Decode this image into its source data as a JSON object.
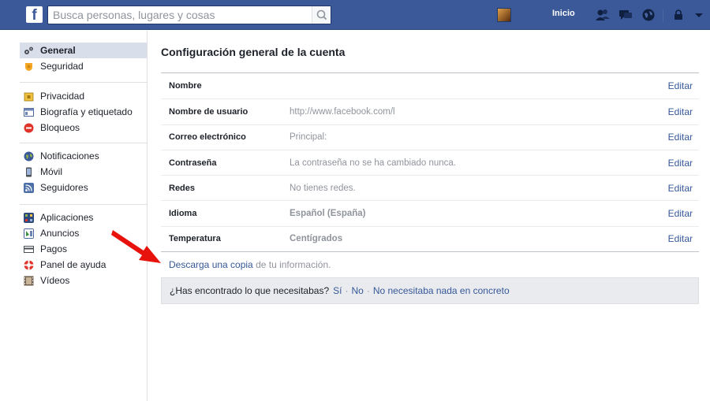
{
  "topbar": {
    "logo": "f",
    "search_placeholder": "Busca personas, lugares y cosas",
    "home_label": "Inicio"
  },
  "sidebar": {
    "groups": [
      [
        {
          "label": "General",
          "icon": "gear-icon",
          "active": true
        },
        {
          "label": "Seguridad",
          "icon": "badge-icon"
        }
      ],
      [
        {
          "label": "Privacidad",
          "icon": "lock-icon"
        },
        {
          "label": "Biografía y etiquetado",
          "icon": "timeline-icon"
        },
        {
          "label": "Bloqueos",
          "icon": "block-icon"
        }
      ],
      [
        {
          "label": "Notificaciones",
          "icon": "globe-icon"
        },
        {
          "label": "Móvil",
          "icon": "mobile-icon"
        },
        {
          "label": "Seguidores",
          "icon": "rss-icon"
        }
      ],
      [
        {
          "label": "Aplicaciones",
          "icon": "apps-icon"
        },
        {
          "label": "Anuncios",
          "icon": "ads-icon"
        },
        {
          "label": "Pagos",
          "icon": "card-icon"
        },
        {
          "label": "Panel de ayuda",
          "icon": "lifebuoy-icon"
        },
        {
          "label": "Vídeos",
          "icon": "film-icon"
        }
      ]
    ]
  },
  "main": {
    "title": "Configuración general de la cuenta",
    "rows": [
      {
        "label": "Nombre",
        "value": "",
        "bold": false,
        "edit": "Editar"
      },
      {
        "label": "Nombre de usuario",
        "value": "http://www.facebook.com/l",
        "bold": false,
        "edit": "Editar"
      },
      {
        "label": "Correo electrónico",
        "value": "Principal:",
        "bold": false,
        "edit": "Editar"
      },
      {
        "label": "Contraseña",
        "value": "La contraseña no se ha cambiado nunca.",
        "bold": false,
        "edit": "Editar"
      },
      {
        "label": "Redes",
        "value": "No tienes redes.",
        "bold": false,
        "edit": "Editar"
      },
      {
        "label": "Idioma",
        "value": "Español (España)",
        "bold": true,
        "edit": "Editar"
      },
      {
        "label": "Temperatura",
        "value": "Centígrados",
        "bold": true,
        "edit": "Editar"
      }
    ],
    "download": {
      "prefix": "Descarga una copia",
      "suffix": " de tu información."
    },
    "feedback": {
      "question": "¿Has encontrado lo que necesitabas?",
      "yes": "Sí",
      "no": "No",
      "nothing": "No necesitaba nada en concreto"
    }
  },
  "colors": {
    "brand": "#3b5998",
    "link": "#365899",
    "arrow": "#e8120c"
  }
}
